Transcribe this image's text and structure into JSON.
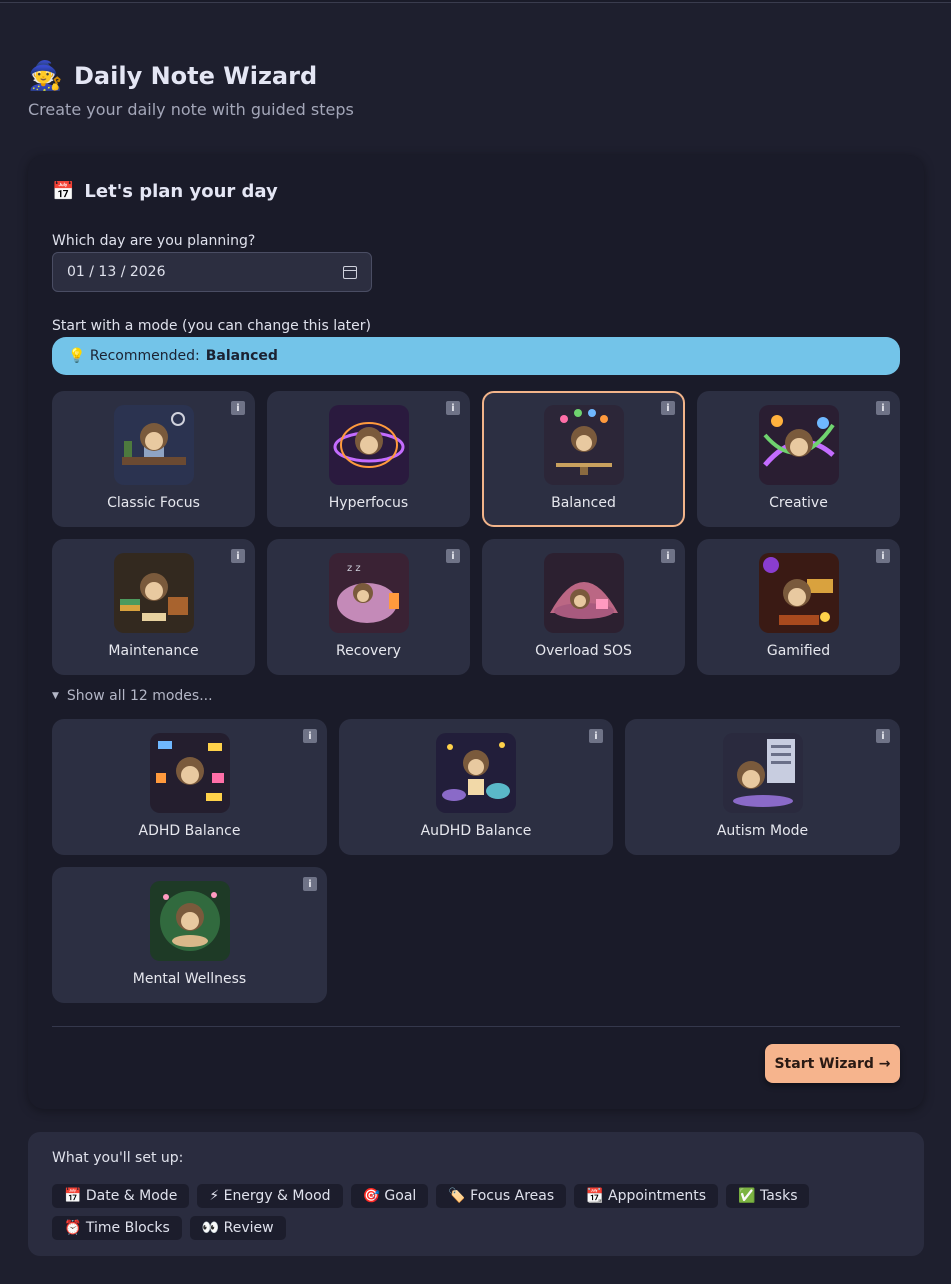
{
  "header": {
    "icon": "🧙",
    "title": "Daily Note Wizard",
    "subtitle": "Create your daily note with guided steps"
  },
  "plan": {
    "icon": "📅",
    "title": "Let's plan your day",
    "date_label": "Which day are you planning?",
    "date_value": "01 / 13 / 2026",
    "mode_label": "Start with a mode (you can change this later)",
    "recommend_prefix": "💡 Recommended:",
    "recommend_value": "Balanced"
  },
  "modes": [
    {
      "label": "Classic Focus",
      "info": "i"
    },
    {
      "label": "Hyperfocus",
      "info": "i"
    },
    {
      "label": "Balanced",
      "info": "i",
      "selected": true
    },
    {
      "label": "Creative",
      "info": "i"
    },
    {
      "label": "Maintenance",
      "info": "i"
    },
    {
      "label": "Recovery",
      "info": "i"
    },
    {
      "label": "Overload SOS",
      "info": "i"
    },
    {
      "label": "Gamified",
      "info": "i"
    }
  ],
  "show_all": {
    "icon": "▼",
    "label": "Show all 12 modes..."
  },
  "extra_modes": [
    {
      "label": "ADHD Balance",
      "info": "i"
    },
    {
      "label": "AuDHD Balance",
      "info": "i"
    },
    {
      "label": "Autism Mode",
      "info": "i"
    },
    {
      "label": "Mental Wellness",
      "info": "i"
    }
  ],
  "start_button": "Start Wizard →",
  "setup": {
    "title": "What you'll set up:",
    "chips": [
      "📅 Date & Mode",
      "⚡ Energy & Mood",
      "🎯 Goal",
      "🏷️ Focus Areas",
      "📆 Appointments",
      "✅ Tasks",
      "⏰ Time Blocks",
      "👀 Review"
    ]
  },
  "colors": {
    "background": "#1e1f2e",
    "card": "#1a1b29",
    "tile": "#2c2f42",
    "accent": "#f6b48d",
    "recommend": "#73c4e9"
  }
}
